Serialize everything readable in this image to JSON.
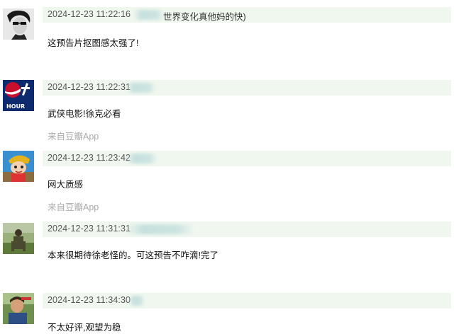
{
  "comments": [
    {
      "time": "2024-12-23 11:22:16",
      "name_visible": "世界变化真他妈的快)",
      "content": "这预告片抠图感太强了!",
      "source": ""
    },
    {
      "time": "2024-12-23 11:22:31",
      "name_visible": "",
      "content": "武侠电影!徐克必看",
      "source": "来自豆瓣App"
    },
    {
      "time": "2024-12-23 11:23:42",
      "name_visible": "",
      "content": "网大质感",
      "source": "来自豆瓣App"
    },
    {
      "time": "2024-12-23 11:31:31",
      "name_visible": "",
      "content": "本来很期待徐老怪的。可这预告不咋滴!完了",
      "source": ""
    },
    {
      "time": "2024-12-23 11:34:30",
      "name_visible": "",
      "content": "不太好评,观望为稳",
      "source": ""
    }
  ],
  "avatar_text": {
    "pepsi": "HOUR"
  },
  "colors": {
    "meta_bar": "#f0f7ef",
    "username": "#3d7fb0",
    "source": "#aaaaaa"
  }
}
